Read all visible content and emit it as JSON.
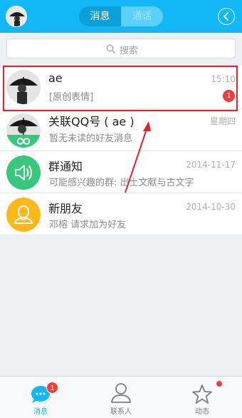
{
  "header": {
    "tab_messages": "消息",
    "tab_calls": "通话"
  },
  "search": {
    "placeholder": "搜索"
  },
  "conversations": [
    {
      "name": "ae",
      "message": "[原创表情]",
      "time": "15:10",
      "unread": "1"
    },
    {
      "name": "关联QQ号 ( ae )",
      "message": "暂无未读的好友消息",
      "time": "星期四"
    },
    {
      "name": "群通知",
      "message": "可能感兴趣的群: 出土文献与古文字",
      "time": "2014-11-17"
    },
    {
      "name": "新朋友",
      "message": "邓榕 请求加为好友",
      "time": "2014-10-30"
    }
  ],
  "tabbar": {
    "messages": "消息",
    "messages_badge": "1",
    "contacts": "联系人",
    "moments": "动态"
  },
  "colors": {
    "accent": "#12b7f5",
    "badge": "#f43c3c",
    "annotation": "#e81f24",
    "group_notice": "#36c97b",
    "new_friend": "#fbb919"
  }
}
